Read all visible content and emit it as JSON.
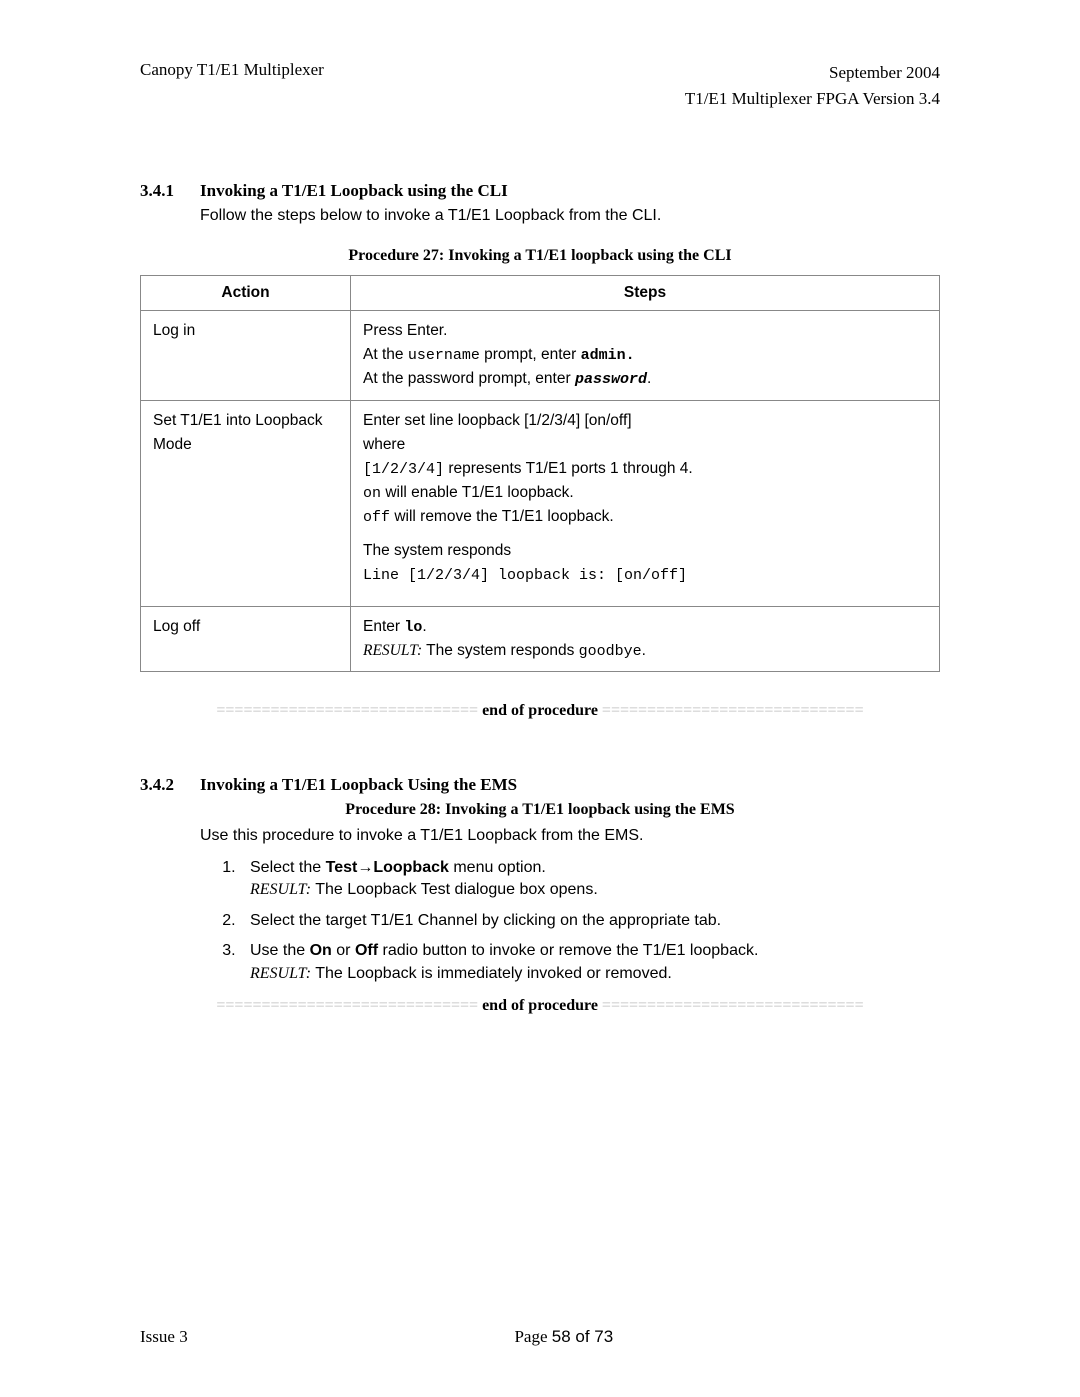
{
  "header": {
    "left": "Canopy T1/E1 Multiplexer",
    "right_line1": "September 2004",
    "right_line2": "T1/E1 Multiplexer FPGA Version 3.4"
  },
  "section1": {
    "number": "3.4.1",
    "title": "Invoking a T1/E1 Loopback using the CLI",
    "intro": "Follow the steps below to invoke a T1/E1 Loopback from the CLI.",
    "procedure_title": "Procedure 27: Invoking a T1/E1 loopback using the CLI"
  },
  "table": {
    "header_action": "Action",
    "header_steps": "Steps",
    "rows": [
      {
        "action": "Log in",
        "steps_plain1": "Press Enter.",
        "steps_at1": "At the ",
        "steps_mono1": "username",
        "steps_after1": " prompt, enter ",
        "steps_bold1": "admin.",
        "steps_at2": "At the password prompt, enter ",
        "steps_bolditalic": "password",
        "steps_period": "."
      },
      {
        "action": "Set T1/E1 into Loopback Mode",
        "line1": "Enter set line loopback [1/2/3/4] [on/off]",
        "line2": "where",
        "mono_a": "[1/2/3/4]",
        "after_a": " represents T1/E1 ports 1 through 4.",
        "mono_b": "on",
        "after_b": " will enable T1/E1 loopback.",
        "mono_c": "off",
        "after_c": " will remove the T1/E1 loopback.",
        "respond": "The system responds",
        "respond_mono": "Line [1/2/3/4] loopback is: [on/off]"
      },
      {
        "action": "Log off",
        "enter": "Enter ",
        "lo": "lo",
        "period": ".",
        "result_label": "RESULT:",
        "result_text": " The system responds ",
        "goodbye": "goodbye",
        "period2": "."
      }
    ]
  },
  "eop": {
    "line": "=============================",
    "text": " end of procedure ",
    "line2": "============================="
  },
  "section2": {
    "number": "3.4.2",
    "title": "Invoking a T1/E1 Loopback Using the EMS",
    "procedure_title": "Procedure 28: Invoking a T1/E1 loopback using the EMS",
    "intro": "Use this procedure to invoke a T1/E1 Loopback from the EMS."
  },
  "olist": {
    "item1_a": "Select the ",
    "item1_b": "Test",
    "item1_arrow": "→",
    "item1_c": "Loopback",
    "item1_d": " menu option.",
    "item1_result_label": "RESULT:",
    "item1_result": " The Loopback Test dialogue box opens.",
    "item2": "Select the target T1/E1 Channel by clicking on the appropriate tab.",
    "item3_a": "Use the ",
    "item3_on": "On",
    "item3_b": " or ",
    "item3_off": "Off",
    "item3_c": " radio button to invoke or remove the T1/E1 loopback.",
    "item3_result_label": "RESULT:",
    "item3_result": " The Loopback is immediately invoked or removed."
  },
  "footer": {
    "left": "Issue 3",
    "center_prefix": "Page ",
    "center_page": "58 of 73"
  }
}
